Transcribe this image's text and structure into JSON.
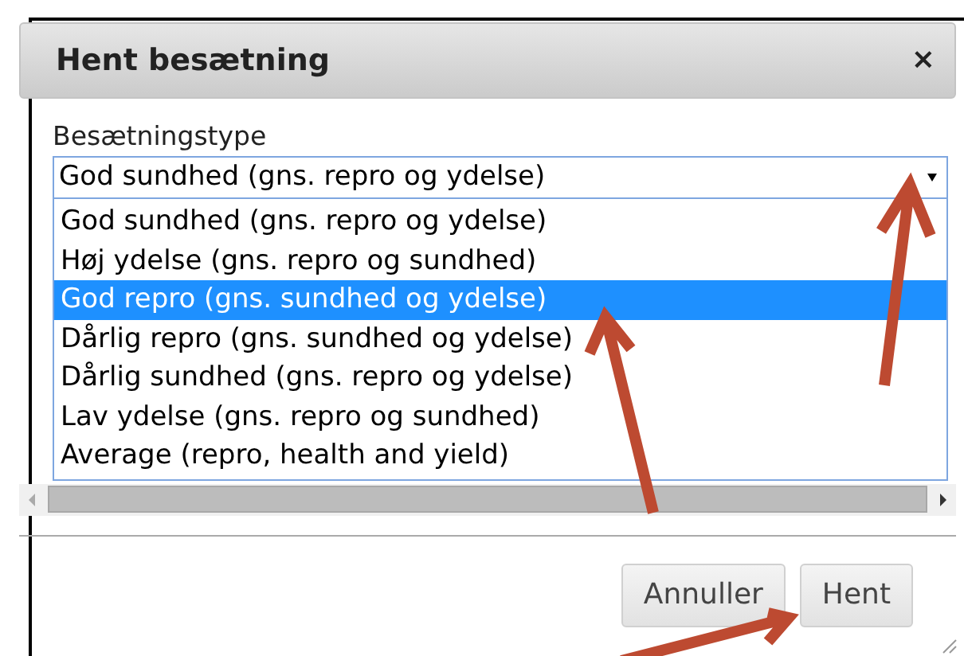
{
  "dialog": {
    "title": "Hent besætning",
    "close": "×"
  },
  "field": {
    "label": "Besætningstype",
    "value": "God sundhed (gns. repro og ydelse)",
    "expanded": true
  },
  "options": [
    {
      "label": "God sundhed (gns. repro og ydelse)",
      "selected": false
    },
    {
      "label": "Høj ydelse (gns. repro og sundhed)",
      "selected": false
    },
    {
      "label": "God repro (gns. sundhed og ydelse)",
      "selected": true
    },
    {
      "label": "Dårlig repro (gns. sundhed og ydelse)",
      "selected": false
    },
    {
      "label": "Dårlig sundhed (gns. repro og ydelse)",
      "selected": false
    },
    {
      "label": "Lav ydelse (gns. repro og sundhed)",
      "selected": false
    },
    {
      "label": "Average (repro, health and yield)",
      "selected": false
    }
  ],
  "buttons": [
    "Annuller",
    "Hent"
  ]
}
